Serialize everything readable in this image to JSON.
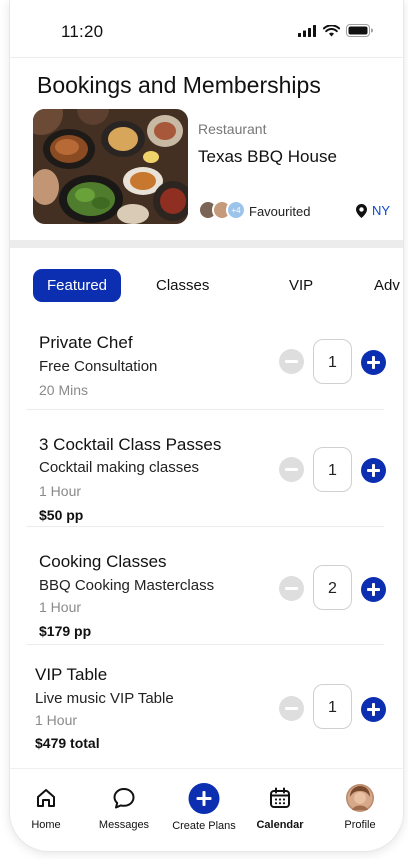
{
  "status_bar": {
    "time": "11:20"
  },
  "page": {
    "title": "Bookings and Memberships"
  },
  "venue": {
    "category": "Restaurant",
    "name": "Texas BBQ House",
    "extra_count": "+4",
    "favourited_label": "Favourited",
    "location": "NY"
  },
  "tabs": [
    {
      "label": "Featured",
      "active": true
    },
    {
      "label": "Classes",
      "active": false
    },
    {
      "label": "VIP",
      "active": false
    },
    {
      "label": "Adv",
      "active": false
    }
  ],
  "items": [
    {
      "title": "Private Chef",
      "subtitle": "Free Consultation",
      "duration": "20 Mins",
      "price": "",
      "quantity": "1"
    },
    {
      "title": "3 Cocktail Class Passes",
      "subtitle": "Cocktail making classes",
      "duration": "1 Hour",
      "price": "$50 pp",
      "quantity": "1"
    },
    {
      "title": "Cooking Classes",
      "subtitle": "BBQ Cooking Masterclass",
      "duration": "1 Hour",
      "price": "$179 pp",
      "quantity": "2"
    },
    {
      "title": "VIP Table",
      "subtitle": "Live music VIP Table",
      "duration": "1 Hour",
      "price": "$479 total",
      "quantity": "1"
    }
  ],
  "bottom_nav": [
    {
      "label": "Home",
      "icon": "home-icon"
    },
    {
      "label": "Messages",
      "icon": "message-icon"
    },
    {
      "label": "Create Plans",
      "icon": "plus-circle-icon"
    },
    {
      "label": "Calendar",
      "icon": "calendar-icon",
      "active": true
    },
    {
      "label": "Profile",
      "icon": "profile-avatar"
    }
  ],
  "colors": {
    "accent": "#0b2fb0",
    "link": "#0b49c8",
    "muted": "#8a8a8a"
  }
}
